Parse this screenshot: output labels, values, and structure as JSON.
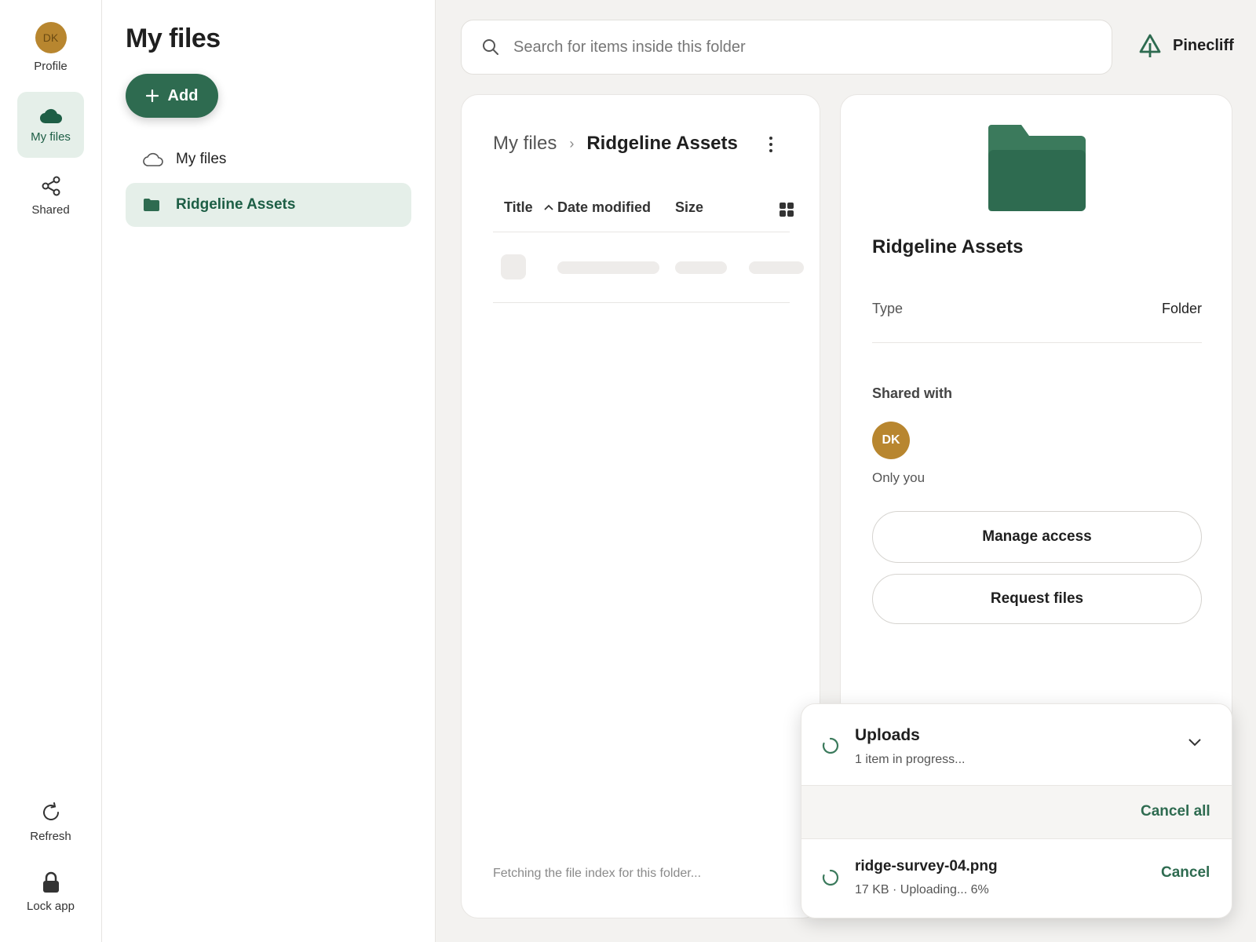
{
  "rail": {
    "profile": {
      "initials": "DK",
      "label": "Profile"
    },
    "my_files": "My files",
    "shared": "Shared",
    "refresh": "Refresh",
    "lock": "Lock app"
  },
  "tree": {
    "title": "My files",
    "add_label": "Add",
    "items": [
      {
        "label": "My files",
        "icon": "cloud-outline-icon"
      },
      {
        "label": "Ridgeline Assets",
        "icon": "folder-icon"
      }
    ]
  },
  "search": {
    "placeholder": "Search for items inside this folder"
  },
  "brand": {
    "name": "Pinecliff"
  },
  "files": {
    "breadcrumb": [
      "My files",
      "Ridgeline Assets"
    ],
    "columns": [
      "Title",
      "Date modified",
      "Size"
    ],
    "fetching": "Fetching the file index for this folder..."
  },
  "details": {
    "title": "Ridgeline Assets",
    "type_label": "Type",
    "type_value": "Folder",
    "shared_with_label": "Shared with",
    "shared_initials": "DK",
    "shared_desc": "Only you",
    "manage_access": "Manage access",
    "request_files": "Request files"
  },
  "uploads": {
    "title": "Uploads",
    "status": "1 item in progress...",
    "cancel_all": "Cancel all",
    "file": {
      "name": "ridge-survey-04.png",
      "meta": "17 KB · Uploading... 6%",
      "progress_percent": 6
    },
    "cancel": "Cancel"
  },
  "colors": {
    "accent": "#2e6b50",
    "avatar": "#b8862f",
    "active_bg": "#e5efe9"
  }
}
